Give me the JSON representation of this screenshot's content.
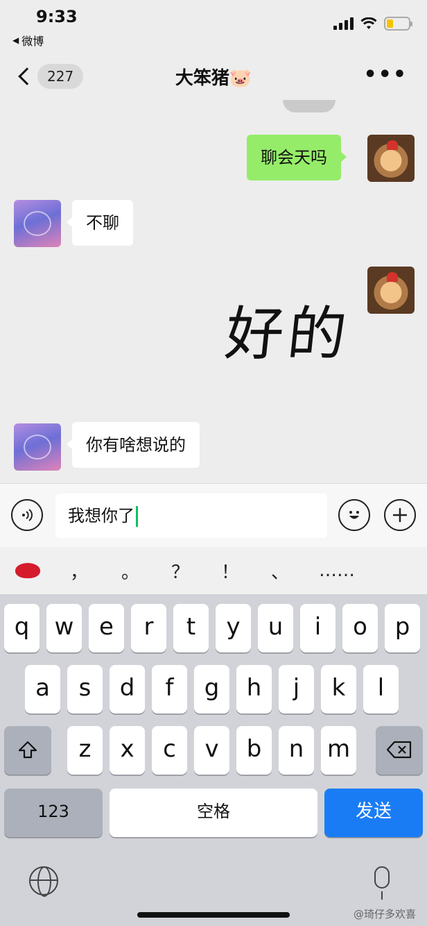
{
  "status_bar": {
    "time": "9:33",
    "back_app": "微博"
  },
  "nav": {
    "badge": "227",
    "title": "大笨猪🐷",
    "more": "•••"
  },
  "messages": [
    {
      "from": "me",
      "text": "聊会天吗"
    },
    {
      "from": "other",
      "text": "不聊"
    },
    {
      "from": "me",
      "text": "好的",
      "type": "handwritten-sticker"
    },
    {
      "from": "other",
      "text": "你有啥想说的"
    }
  ],
  "input": {
    "value": "我想你了"
  },
  "suggestions": [
    "，",
    "。",
    "？",
    "！",
    "、",
    "……"
  ],
  "keyboard": {
    "row1": [
      "q",
      "w",
      "e",
      "r",
      "t",
      "y",
      "u",
      "i",
      "o",
      "p"
    ],
    "row2": [
      "a",
      "s",
      "d",
      "f",
      "g",
      "h",
      "j",
      "k",
      "l"
    ],
    "row3": [
      "z",
      "x",
      "c",
      "v",
      "b",
      "n",
      "m"
    ],
    "numbers_key": "123",
    "space_key": "空格",
    "send_key": "发送"
  },
  "watermark": "@琦仔多欢喜",
  "colors": {
    "my_bubble": "#95ec69",
    "send_key": "#1a7cf5",
    "caret": "#07c160"
  },
  "icons": [
    "voice-icon",
    "emoji-icon",
    "plus-icon",
    "shift-icon",
    "delete-icon",
    "globe-icon",
    "microphone-icon",
    "lips-emoji-icon",
    "weibo-icon"
  ]
}
